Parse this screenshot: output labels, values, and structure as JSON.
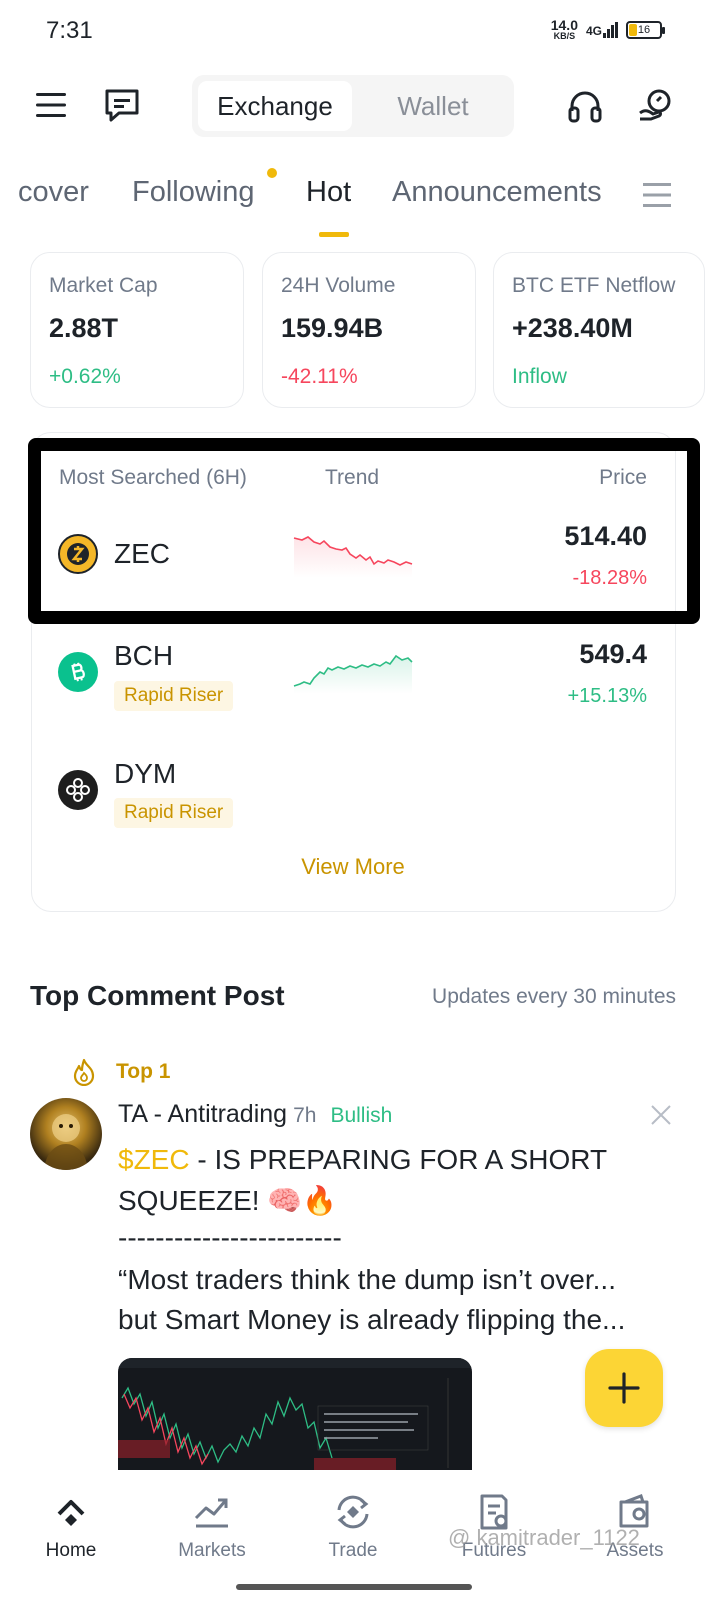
{
  "status_bar": {
    "time": "7:31",
    "net_speed": "14.0",
    "net_unit": "KB/S",
    "network": "4G",
    "battery": "16"
  },
  "header": {
    "segments": [
      "Exchange",
      "Wallet"
    ],
    "active_segment": "Exchange",
    "icons": [
      "menu-icon",
      "chat-icon",
      "headset-icon",
      "dashboard-icon"
    ]
  },
  "tabs": {
    "items": [
      "cover",
      "Following",
      "Hot",
      "Announcements"
    ],
    "active": "Hot"
  },
  "stats": [
    {
      "label": "Market Cap",
      "value": "2.88T",
      "change": "+0.62%",
      "trend": "up"
    },
    {
      "label": "24H Volume",
      "value": "159.94B",
      "change": "-42.11%",
      "trend": "down"
    },
    {
      "label": "BTC ETF Netflow",
      "value": "+238.40M",
      "change": "Inflow",
      "trend": "up"
    }
  ],
  "most_searched": {
    "header": {
      "title": "Most Searched (6H)",
      "trend": "Trend",
      "price": "Price"
    },
    "rows": [
      {
        "symbol": "ZEC",
        "price": "514.40",
        "change": "-18.28%",
        "badge": "",
        "color": "#f6465d",
        "icon_color": "#f4b728"
      },
      {
        "symbol": "BCH",
        "price": "549.4",
        "change": "+15.13%",
        "badge": "Rapid Riser",
        "color": "#2ebd85",
        "icon_color": "#0ac18e"
      },
      {
        "symbol": "DYM",
        "price": "",
        "change": "",
        "badge": "Rapid Riser",
        "color": "",
        "icon_color": "#1e1e1e"
      }
    ],
    "view_more": "View More"
  },
  "top_comment": {
    "title": "Top Comment Post",
    "subtitle": "Updates every 30 minutes",
    "rank": "Top 1",
    "author": "TA - Antitrading",
    "time_ago": "7h",
    "sentiment": "Bullish",
    "ticker": "$ZEC",
    "headline_rest": " - IS PREPARING FOR A SHORT",
    "headline_line2": "SQUEEZE! 🧠🔥",
    "divider": "------------------------",
    "body_line1": "“Most traders think the dump isn’t over...",
    "body_line2": "but Smart Money is already flipping the..."
  },
  "bottom_nav": {
    "items": [
      {
        "label": "Home",
        "icon": "home-icon"
      },
      {
        "label": "Markets",
        "icon": "markets-icon"
      },
      {
        "label": "Trade",
        "icon": "trade-icon"
      },
      {
        "label": "Futures",
        "icon": "futures-icon"
      },
      {
        "label": "Assets",
        "icon": "assets-icon"
      }
    ],
    "active": "Home"
  },
  "watermark": "@ kamitrader_1122",
  "colors": {
    "accent": "#f0b90b",
    "up": "#2ebd85",
    "down": "#f6465d",
    "highlight_border": "#000000"
  }
}
